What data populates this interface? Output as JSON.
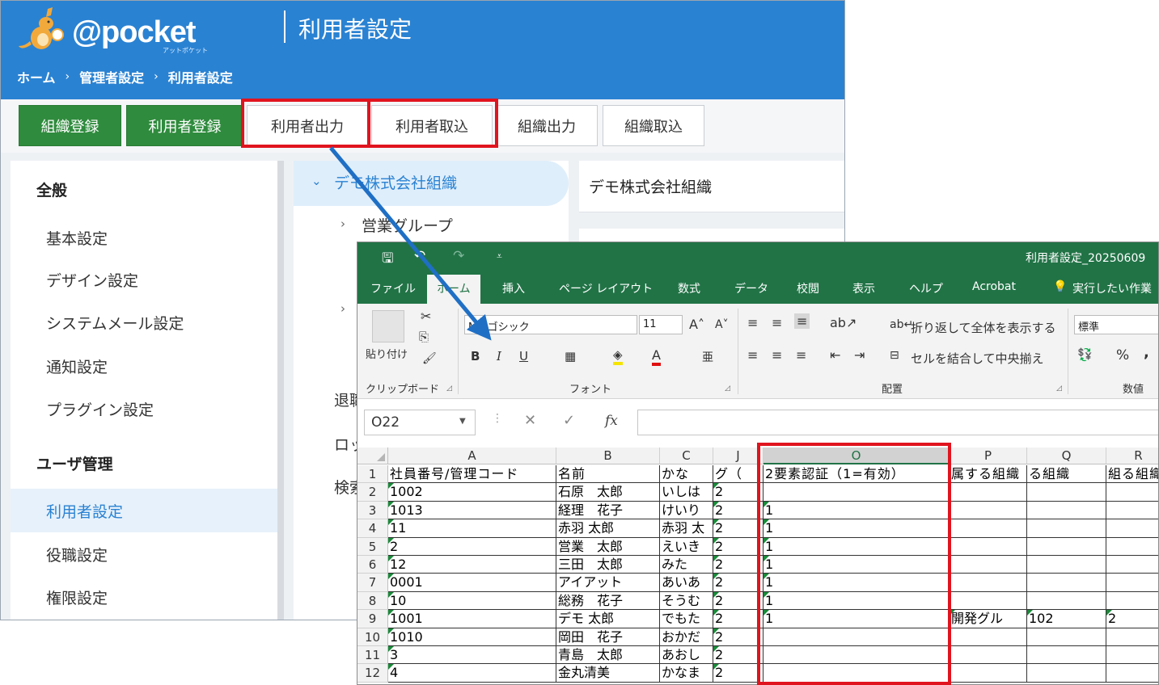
{
  "app": {
    "logo_text": "@pocket",
    "logo_sub": "アットポケット",
    "page_title": "利用者設定",
    "breadcrumb": [
      "ホーム",
      "管理者設定",
      "利用者設定"
    ],
    "breadcrumb_sep": "›"
  },
  "toolbar": {
    "buttons": [
      "組織登録",
      "利用者登録",
      "利用者出力",
      "利用者取込",
      "組織出力",
      "組織取込"
    ]
  },
  "sidebar": {
    "section_general": "全般",
    "general_items": [
      "基本設定",
      "デザイン設定",
      "システムメール設定",
      "通知設定",
      "プラグイン設定"
    ],
    "section_user": "ユーザ管理",
    "user_items": [
      "利用者設定",
      "役職設定",
      "権限設定"
    ]
  },
  "tree": {
    "root": "デモ株式会社組織",
    "child": "営業グループ",
    "partial_labels": [
      "退職",
      "ロッ",
      "検索"
    ]
  },
  "detail": {
    "title": "デモ株式会社組織"
  },
  "excel": {
    "filename": "利用者設定_20250609",
    "tabs": [
      "ファイル",
      "ホーム",
      "挿入",
      "ページ レイアウト",
      "数式",
      "データ",
      "校閲",
      "表示",
      "ヘルプ",
      "Acrobat",
      "実行したい作業"
    ],
    "ribbon": {
      "paste_label": "貼り付け",
      "clipboard_label": "クリップボード",
      "font_name": "MS ゴシック",
      "font_size": "11",
      "font_label": "フォント",
      "bold": "B",
      "italic": "I",
      "underline": "U",
      "wrap_text": "折り返して全体を表示する",
      "merge_center": "セルを結合して中央揃え",
      "align_label": "配置",
      "number_format": "標準",
      "number_label": "数値",
      "percent": "%",
      "comma": ","
    },
    "name_box": "O22",
    "fx": "fx",
    "columns": [
      "A",
      "B",
      "C",
      "J",
      "O",
      "P",
      "Q",
      "R"
    ],
    "rows": [
      [
        "1",
        "社員番号/管理コード",
        "名前",
        "かな",
        "グ（",
        "2要素認証（1=有効）",
        "属する組織",
        "る組織",
        "組る組織"
      ],
      [
        "2",
        "1002",
        "石原　太郎",
        "いしは",
        "2",
        "",
        "",
        "",
        ""
      ],
      [
        "3",
        "1013",
        "経理　花子",
        "けいり",
        "2",
        "1",
        "",
        "",
        ""
      ],
      [
        "4",
        "11",
        "赤羽 太郎",
        "赤羽 太",
        "2",
        "1",
        "",
        "",
        ""
      ],
      [
        "5",
        "2",
        "営業　太郎",
        "えいき",
        "2",
        "1",
        "",
        "",
        ""
      ],
      [
        "6",
        "12",
        "三田　太郎",
        "みた",
        "2",
        "1",
        "",
        "",
        ""
      ],
      [
        "7",
        "0001",
        "アイアット",
        "あいあ",
        "2",
        "1",
        "",
        "",
        ""
      ],
      [
        "8",
        "10",
        "総務　花子",
        "そうむ",
        "2",
        "1",
        "",
        "",
        ""
      ],
      [
        "9",
        "1001",
        "デモ 太郎",
        "でもた",
        "2",
        "1",
        "開発グル",
        "102",
        "2"
      ],
      [
        "10",
        "1010",
        "岡田　花子",
        "おかだ",
        "2",
        "",
        "",
        "",
        ""
      ],
      [
        "11",
        "3",
        "青島　太郎",
        "あおし",
        "2",
        "",
        "",
        "",
        ""
      ],
      [
        "12",
        "4",
        "金丸清美",
        "かなま",
        "2",
        "",
        "",
        "",
        ""
      ]
    ]
  },
  "colors": {
    "header_blue": "#2a82d2",
    "green_button": "#2f8b3d",
    "excel_green": "#217346",
    "highlight_red": "#e0141e",
    "arrow_blue": "#1f6fc5"
  }
}
